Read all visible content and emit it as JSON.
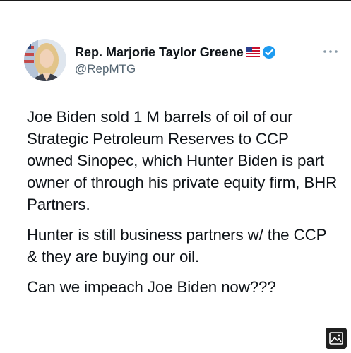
{
  "tweet": {
    "author": {
      "display_name": "Rep. Marjorie Taylor Greene",
      "handle": "@RepMTG",
      "avatar": "avatar",
      "flag_icon": "us-flag-icon",
      "verified_icon": "verified-badge-icon"
    },
    "paragraphs": [
      "Joe Biden sold 1 M barrels of oil of our Strategic Petroleum Reserves to CCP owned Sinopec, which Hunter Biden is part owner of through his private equity firm, BHR Partners.",
      "Hunter is still business partners w/ the CCP & they are buying our oil.",
      "Can we impeach Joe Biden now???"
    ],
    "more_icon": "more-options-icon",
    "media_icon": "image-icon"
  },
  "colors": {
    "text": "#0f1419",
    "secondary_text": "#536471",
    "verified": "#1d9bf0"
  }
}
